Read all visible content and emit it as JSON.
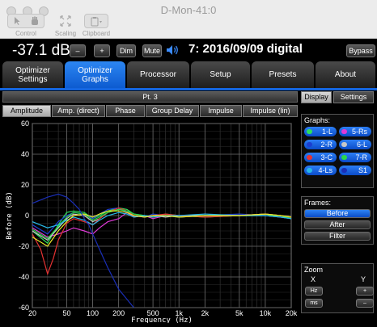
{
  "window": {
    "title": "D-Mon-41:0"
  },
  "toolbar": {
    "control": "Control",
    "scaling": "Scaling",
    "clipboard": "Clipboard"
  },
  "header": {
    "volume": "-37.1 dB",
    "minus": "–",
    "plus": "+",
    "dim": "Dim",
    "mute": "Mute",
    "preset": "7: 2016/09/09 digital",
    "bypass": "Bypass"
  },
  "tabs": [
    {
      "label": "Optimizer Settings"
    },
    {
      "label": "Optimizer Graphs"
    },
    {
      "label": "Processor"
    },
    {
      "label": "Setup"
    },
    {
      "label": "Presets"
    },
    {
      "label": "About"
    }
  ],
  "point_bar": "Pt. 3",
  "subtabs": [
    {
      "label": "Amplitude"
    },
    {
      "label": "Amp. (direct)"
    },
    {
      "label": "Phase"
    },
    {
      "label": "Group Delay"
    },
    {
      "label": "Impulse"
    },
    {
      "label": "Impulse (lin)"
    }
  ],
  "side_tabs": {
    "display": "Display",
    "settings": "Settings"
  },
  "graphs": {
    "heading": "Graphs:",
    "items": [
      {
        "label": "1-L",
        "color": "#2de05a"
      },
      {
        "label": "5-Rs",
        "color": "#e03ad8"
      },
      {
        "label": "2-R",
        "color": "#1c3ed0"
      },
      {
        "label": "6-L",
        "color": "#c8c8c8"
      },
      {
        "label": "3-C",
        "color": "#e63232"
      },
      {
        "label": "7-R",
        "color": "#2ad84a"
      },
      {
        "label": "4-Ls",
        "color": "#28b8e8"
      },
      {
        "label": "S1",
        "color": "#1a2fb8"
      }
    ]
  },
  "frames": {
    "heading": "Frames:",
    "before": "Before",
    "after": "After",
    "filter": "Filter"
  },
  "zoom": {
    "heading": "Zoom",
    "x": "X",
    "y": "Y",
    "hz": "Hz",
    "ms": "ms",
    "plus": "+",
    "minus": "–"
  },
  "chart_data": {
    "type": "line",
    "ylabel": "Before (dB)",
    "xlabel": "Frequency (Hz)",
    "xscale": "log",
    "xlim": [
      20,
      20000
    ],
    "ylim": [
      -60,
      60
    ],
    "x_ticks": [
      {
        "v": 20,
        "t": "20"
      },
      {
        "v": 50,
        "t": "50"
      },
      {
        "v": 100,
        "t": "100"
      },
      {
        "v": 200,
        "t": "200"
      },
      {
        "v": 500,
        "t": "500"
      },
      {
        "v": 1000,
        "t": "1k"
      },
      {
        "v": 2000,
        "t": "2k"
      },
      {
        "v": 5000,
        "t": "5k"
      },
      {
        "v": 10000,
        "t": "10k"
      },
      {
        "v": 20000,
        "t": "20k"
      }
    ],
    "y_ticks": [
      60,
      40,
      20,
      0,
      -20,
      -40,
      -60
    ],
    "grid": true,
    "series": [
      {
        "color": "#2de05a",
        "points": [
          [
            20,
            -10
          ],
          [
            30,
            -18
          ],
          [
            40,
            -6
          ],
          [
            50,
            2
          ],
          [
            60,
            3
          ],
          [
            80,
            2
          ],
          [
            100,
            -2
          ],
          [
            120,
            0
          ],
          [
            150,
            3
          ],
          [
            200,
            5
          ],
          [
            250,
            4
          ],
          [
            300,
            1
          ],
          [
            400,
            0
          ],
          [
            500,
            -1
          ],
          [
            700,
            1
          ],
          [
            1000,
            0
          ],
          [
            2000,
            -1
          ],
          [
            5000,
            0
          ],
          [
            10000,
            1
          ],
          [
            15000,
            0
          ],
          [
            20000,
            -1
          ]
        ]
      },
      {
        "color": "#e03ad8",
        "points": [
          [
            20,
            -8
          ],
          [
            30,
            -14
          ],
          [
            40,
            -12
          ],
          [
            50,
            -10
          ],
          [
            60,
            -8
          ],
          [
            80,
            -10
          ],
          [
            100,
            -12
          ],
          [
            120,
            -8
          ],
          [
            150,
            -4
          ],
          [
            200,
            -2
          ],
          [
            250,
            2
          ],
          [
            300,
            -1
          ],
          [
            400,
            0
          ],
          [
            500,
            -2
          ],
          [
            700,
            0
          ],
          [
            1000,
            -1
          ],
          [
            2000,
            0
          ],
          [
            5000,
            0
          ],
          [
            10000,
            0
          ],
          [
            15000,
            -1
          ],
          [
            20000,
            -2
          ]
        ]
      },
      {
        "color": "#1c3ed0",
        "points": [
          [
            20,
            -6
          ],
          [
            30,
            -12
          ],
          [
            40,
            -4
          ],
          [
            50,
            0
          ],
          [
            60,
            2
          ],
          [
            80,
            1
          ],
          [
            100,
            -2
          ],
          [
            120,
            1
          ],
          [
            150,
            4
          ],
          [
            200,
            5
          ],
          [
            250,
            2
          ],
          [
            300,
            0
          ],
          [
            400,
            -1
          ],
          [
            500,
            1
          ],
          [
            700,
            0
          ],
          [
            1000,
            0
          ],
          [
            2000,
            0
          ],
          [
            5000,
            1
          ],
          [
            10000,
            0
          ],
          [
            15000,
            -1
          ],
          [
            20000,
            -2
          ]
        ]
      },
      {
        "color": "#c8c8c8",
        "points": [
          [
            20,
            -10
          ],
          [
            30,
            -16
          ],
          [
            40,
            -8
          ],
          [
            50,
            -2
          ],
          [
            60,
            1
          ],
          [
            80,
            0
          ],
          [
            100,
            -4
          ],
          [
            120,
            -2
          ],
          [
            150,
            2
          ],
          [
            200,
            4
          ],
          [
            250,
            3
          ],
          [
            300,
            0
          ],
          [
            400,
            -1
          ],
          [
            500,
            0
          ],
          [
            700,
            -1
          ],
          [
            1000,
            0
          ],
          [
            2000,
            0
          ],
          [
            5000,
            0
          ],
          [
            10000,
            1
          ],
          [
            15000,
            0
          ],
          [
            20000,
            -2
          ]
        ]
      },
      {
        "color": "#e63232",
        "points": [
          [
            20,
            -12
          ],
          [
            25,
            -22
          ],
          [
            30,
            -38
          ],
          [
            35,
            -28
          ],
          [
            40,
            -16
          ],
          [
            50,
            -5
          ],
          [
            60,
            -2
          ],
          [
            80,
            -4
          ],
          [
            100,
            -6
          ],
          [
            120,
            -2
          ],
          [
            150,
            2
          ],
          [
            200,
            5
          ],
          [
            250,
            3
          ],
          [
            300,
            0
          ],
          [
            400,
            -1
          ],
          [
            500,
            0
          ],
          [
            700,
            1
          ],
          [
            1000,
            0
          ],
          [
            2000,
            -1
          ],
          [
            5000,
            0
          ],
          [
            10000,
            1
          ],
          [
            15000,
            0
          ],
          [
            20000,
            -1
          ]
        ]
      },
      {
        "color": "#2ad84a",
        "points": [
          [
            20,
            -9
          ],
          [
            30,
            -15
          ],
          [
            40,
            -7
          ],
          [
            50,
            -1
          ],
          [
            60,
            2
          ],
          [
            80,
            1
          ],
          [
            100,
            -3
          ],
          [
            120,
            -1
          ],
          [
            150,
            2
          ],
          [
            200,
            4
          ],
          [
            250,
            3
          ],
          [
            300,
            1
          ],
          [
            400,
            0
          ],
          [
            500,
            -1
          ],
          [
            700,
            0
          ],
          [
            1000,
            -1
          ],
          [
            2000,
            0
          ],
          [
            5000,
            0
          ],
          [
            10000,
            0
          ],
          [
            15000,
            0
          ],
          [
            20000,
            -2
          ]
        ]
      },
      {
        "color": "#28b8e8",
        "points": [
          [
            20,
            -4
          ],
          [
            30,
            -8
          ],
          [
            40,
            -6
          ],
          [
            50,
            -3
          ],
          [
            60,
            -1
          ],
          [
            80,
            -3
          ],
          [
            100,
            -6
          ],
          [
            120,
            -3
          ],
          [
            150,
            0
          ],
          [
            200,
            2
          ],
          [
            250,
            1
          ],
          [
            300,
            -1
          ],
          [
            400,
            0
          ],
          [
            500,
            -1
          ],
          [
            700,
            0
          ],
          [
            1000,
            0
          ],
          [
            2000,
            1
          ],
          [
            5000,
            0
          ],
          [
            10000,
            0
          ],
          [
            15000,
            -1
          ],
          [
            20000,
            -2
          ]
        ]
      },
      {
        "color": "#ecec2a",
        "points": [
          [
            20,
            -14
          ],
          [
            30,
            -20
          ],
          [
            40,
            -10
          ],
          [
            50,
            -4
          ],
          [
            60,
            0
          ],
          [
            80,
            1
          ],
          [
            100,
            -1
          ],
          [
            120,
            1
          ],
          [
            150,
            3
          ],
          [
            200,
            3
          ],
          [
            250,
            2
          ],
          [
            300,
            0
          ],
          [
            400,
            -1
          ],
          [
            500,
            0
          ],
          [
            700,
            0
          ],
          [
            1000,
            -1
          ],
          [
            2000,
            0
          ],
          [
            5000,
            0
          ],
          [
            10000,
            1
          ],
          [
            15000,
            0
          ],
          [
            20000,
            -1
          ]
        ]
      },
      {
        "color": "#1a2fb8",
        "points": [
          [
            20,
            8
          ],
          [
            30,
            12
          ],
          [
            40,
            14
          ],
          [
            50,
            12
          ],
          [
            60,
            8
          ],
          [
            70,
            4
          ],
          [
            80,
            -2
          ],
          [
            90,
            -6
          ],
          [
            100,
            -12
          ],
          [
            120,
            -22
          ],
          [
            150,
            -34
          ],
          [
            200,
            -48
          ],
          [
            300,
            -60
          ]
        ]
      }
    ]
  }
}
